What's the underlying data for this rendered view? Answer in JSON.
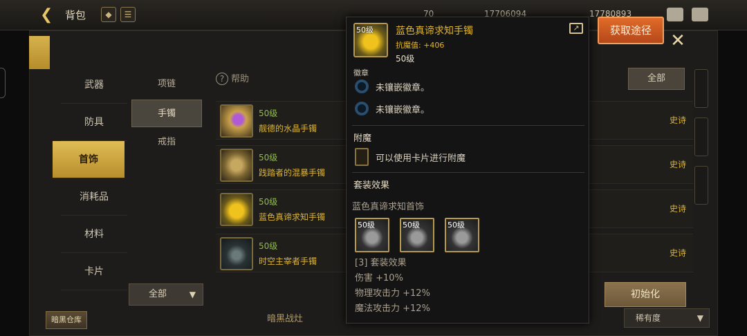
{
  "topbar": {
    "title": "背包",
    "currency_1": "70",
    "currency_2": "17706094",
    "currency_3": "17780893"
  },
  "categories": [
    {
      "label": "武器"
    },
    {
      "label": "防具"
    },
    {
      "label": "首饰"
    },
    {
      "label": "消耗品"
    },
    {
      "label": "材料"
    },
    {
      "label": "卡片"
    }
  ],
  "subcategories": [
    {
      "label": "项链"
    },
    {
      "label": "手镯"
    },
    {
      "label": "戒指"
    }
  ],
  "help_label": "帮助",
  "filter_all_top": "全部",
  "items": [
    {
      "level": "50级",
      "name": "靓德的水晶手镯",
      "rarity": "史诗",
      "color": "#8e3fb8"
    },
    {
      "level": "50级",
      "name": "践踏者的混暴手镯",
      "rarity": "史诗",
      "color": "#a38a4a"
    },
    {
      "level": "50级",
      "name": "蓝色真谛求知手镯",
      "rarity": "史诗",
      "color": "#e2b630"
    },
    {
      "level": "50级",
      "name": "时空主宰者手镯",
      "rarity": "史诗",
      "color": "#2f3436"
    }
  ],
  "filter_all_bottom": "全部",
  "init_button": "初始化",
  "sort_select": "稀有度",
  "storage_tab": "暗黑仓库",
  "bottom_label": "暗黑战灶",
  "popup": {
    "icon_level": "50级",
    "title": "蓝色真谛求知手镯",
    "stat": "抗魔值: +406",
    "level": "50级",
    "cut_label": "徽章",
    "badge_1": "未镶嵌徽章。",
    "badge_2": "未镶嵌徽章。",
    "enchant_title": "附魔",
    "enchant_text": "可以使用卡片进行附魔",
    "set_title": "套装效果",
    "set_name": "蓝色真谛求知首饰",
    "set_pieces": [
      {
        "level": "50级"
      },
      {
        "level": "50级"
      },
      {
        "level": "50级"
      }
    ],
    "set_effect_header": "[3] 套装效果",
    "set_effect_1": "伤害 +10%",
    "set_effect_2": "物理攻击力 +12%",
    "set_effect_3": "魔法攻击力 +12%"
  },
  "get_button": "获取途径",
  "colors": {
    "gold": "#e2b630",
    "accent_orange": "#d85d22",
    "level_green": "#8fbf45"
  }
}
